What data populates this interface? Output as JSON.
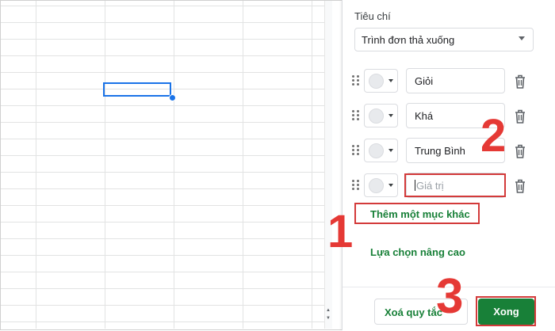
{
  "panel": {
    "criteria_label": "Tiêu chí",
    "criteria_value": "Trình đơn thả xuống",
    "items": [
      {
        "value": "Giỏi",
        "placeholder": ""
      },
      {
        "value": "Khá",
        "placeholder": ""
      },
      {
        "value": "Trung Bình",
        "placeholder": ""
      },
      {
        "value": "",
        "placeholder": "Giá trị"
      }
    ],
    "add_item_label": "Thêm một mục khác",
    "advanced_label": "Lựa chọn nâng cao",
    "remove_rule_label": "Xoá quy tắc",
    "done_label": "Xong"
  },
  "annotations": {
    "step1": "1",
    "step2": "2",
    "step3": "3"
  },
  "colors": {
    "accent_green": "#188038",
    "annotation_red": "#e53935",
    "selection_blue": "#1a73e8"
  }
}
